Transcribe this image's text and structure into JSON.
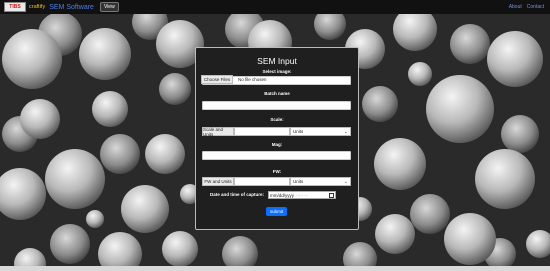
{
  "navbar": {
    "logo_badge": "TIBS",
    "logo_text": "craftify",
    "brand": "SEM Software",
    "view_label": "View",
    "about_label": "About",
    "contact_label": "Contact"
  },
  "form": {
    "title": "SEM Input",
    "select_image_label": "Select image:",
    "choose_files_label": "Choose Files",
    "no_file_text": "No file chosen",
    "batch_name_label": "Batch name",
    "scale_label": "Scale:",
    "scale_units_label": "Scale and Units",
    "scale_units_select": "Units",
    "mag_label": "Mag:",
    "fw_label": "FW:",
    "fw_units_label": "FW and Units",
    "fw_units_select": "Units",
    "date_label": "Date and time of capture:",
    "date_placeholder": "mm/dd/yyyy",
    "date_time_placeholder": "--:-- --",
    "submit_label": "submit"
  },
  "colors": {
    "navbar_bg": "#111111",
    "brand": "#4d7fe6",
    "submit": "#0d6efd"
  }
}
